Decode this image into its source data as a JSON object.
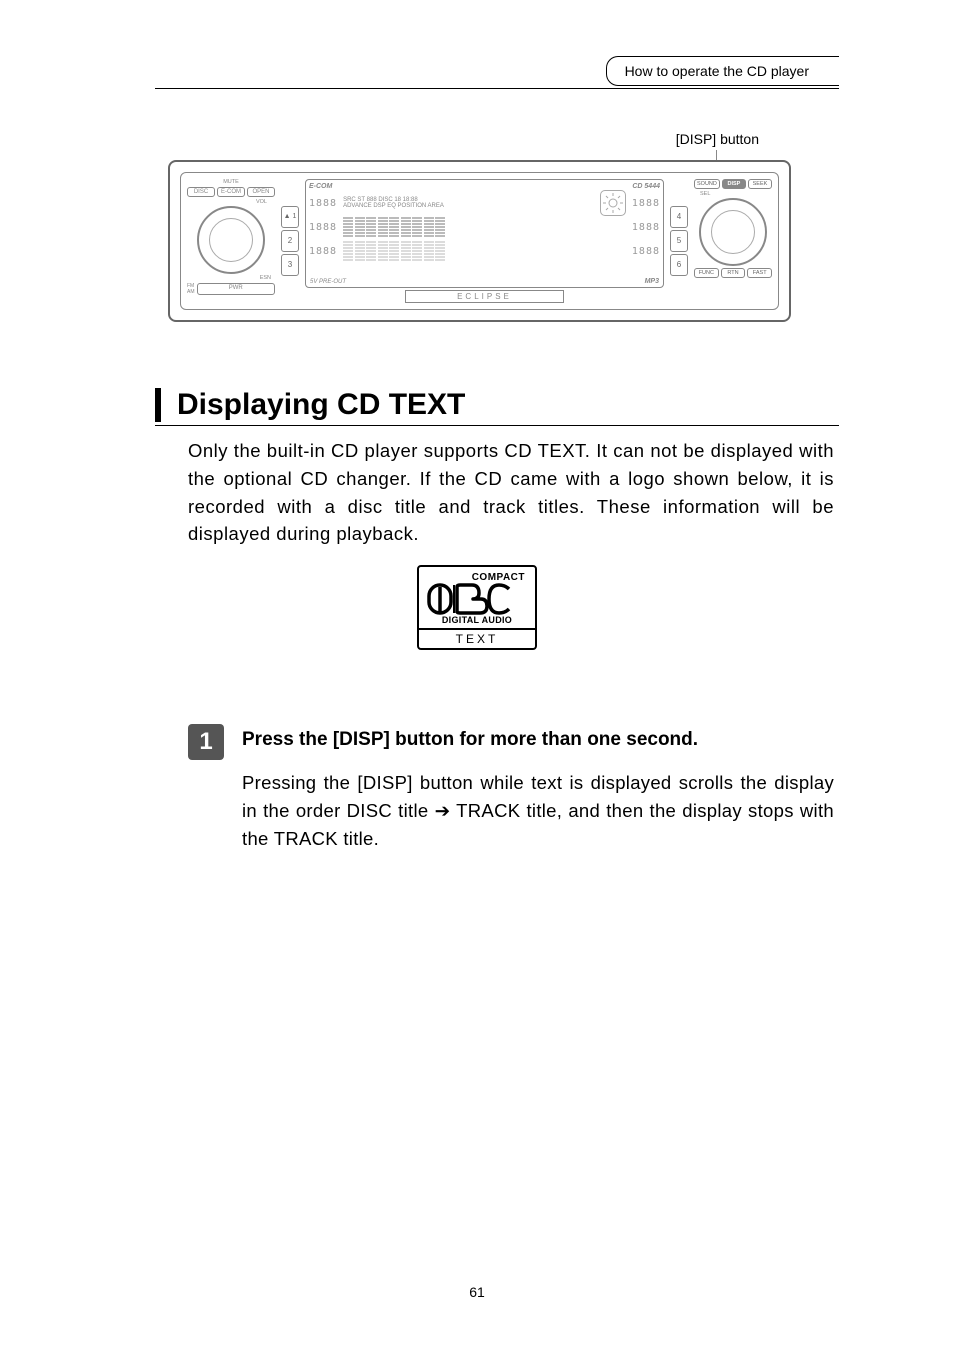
{
  "header": {
    "breadcrumb": "How to operate the CD player"
  },
  "annotation": {
    "disp_button_label": "[DISP] button"
  },
  "device": {
    "left_buttons": [
      "DISC",
      "E-COM",
      "OPEN"
    ],
    "mute_label": "MUTE",
    "vol_label": "VOL",
    "esn_label": "ESN",
    "fm_label": "FM",
    "am_label": "AM",
    "pwr_label": "PWR",
    "eject_symbol": "▲",
    "lcd": {
      "brand": "E-COM",
      "model": "CD 5444",
      "preout": "5V PRE-OUT",
      "mp3": "MP3",
      "labels": [
        "SRC",
        "ST",
        "DISC",
        "ADVANCE",
        "DSP",
        "EQ",
        "POSITION",
        "AREA"
      ],
      "time": "18:88",
      "segs": [
        "1888",
        "1888",
        "1888",
        "1888",
        "1888",
        "1888"
      ]
    },
    "brand_label": "ECLIPSE",
    "num_left": [
      "1",
      "2",
      "3"
    ],
    "num_right": [
      "4",
      "5",
      "6"
    ],
    "right_buttons_top": [
      "SOUND",
      "DISP",
      "SEEK"
    ],
    "sel_label": "SEL",
    "right_buttons_bottom": [
      "FUNC",
      "RTN",
      "FAST"
    ]
  },
  "section": {
    "title": "Displaying CD TEXT",
    "body": "Only the built-in CD player supports CD TEXT. It can not be displayed with the optional CD changer. If the CD came with a logo shown below, it is recorded with a disc title and track titles. These information will be displayed during playback."
  },
  "logo": {
    "compact": "COMPACT",
    "digital_audio": "DIGITAL AUDIO",
    "text_label": "TEXT"
  },
  "step1": {
    "number": "1",
    "title": "Press the [DISP] button for more than one second.",
    "body_part1": "Pressing the [DISP] button while text is displayed scrolls the display in the order DISC title ",
    "arrow": "➔",
    "body_part2": " TRACK title, and then the display stops with the TRACK title."
  },
  "page_number": "61"
}
